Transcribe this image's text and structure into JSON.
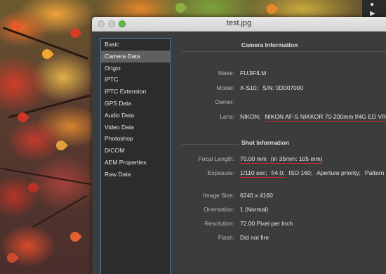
{
  "window": {
    "title": "test.jpg"
  },
  "sidebar": {
    "items": [
      {
        "label": "Basic"
      },
      {
        "label": "Camera Data"
      },
      {
        "label": "Origin"
      },
      {
        "label": "IPTC"
      },
      {
        "label": "IPTC Extension"
      },
      {
        "label": "GPS Data"
      },
      {
        "label": "Audio Data"
      },
      {
        "label": "Video Data"
      },
      {
        "label": "Photoshop"
      },
      {
        "label": "DICOM"
      },
      {
        "label": "AEM Properties"
      },
      {
        "label": "Raw Data"
      }
    ],
    "selected_index": 1
  },
  "camera_info": {
    "heading": "Camera Information",
    "make_label": "Make:",
    "make_value": "FUJIFILM",
    "model_label": "Model:",
    "model_value": "X-S10;",
    "serial_value": "S/N: 0D007000",
    "owner_label": "Owner:",
    "owner_value": "",
    "lens_label": "Lens:",
    "lens_make": "NIKON;",
    "lens_model": "NIKON AF-S NIKKOR 70-200mm f/4G ED VR;"
  },
  "shot_info": {
    "heading": "Shot Information",
    "focal_label": "Focal Length:",
    "focal_value": "70.00 mm",
    "focal_35mm": "(in 35mm: 105 mm)",
    "exposure_label": "Exposure:",
    "shutter": "1/110 sec;",
    "aperture": "f/4.0;",
    "iso": "ISO 160;",
    "mode": "Aperture priority;",
    "pattern": "Pattern",
    "image_size_label": "Image Size:",
    "image_size_value": "6240 x 4160",
    "orientation_label": "Orientation:",
    "orientation_value": "1 (Normal)",
    "resolution_label": "Resolution:",
    "resolution_value": "72.00 Pixel per Inch",
    "flash_label": "Flash:",
    "flash_value": "Did not fire"
  },
  "colors": {
    "highlight_underline": "#d22a2a",
    "selection": "#606060",
    "sidebar_border": "#4d7fa8"
  }
}
